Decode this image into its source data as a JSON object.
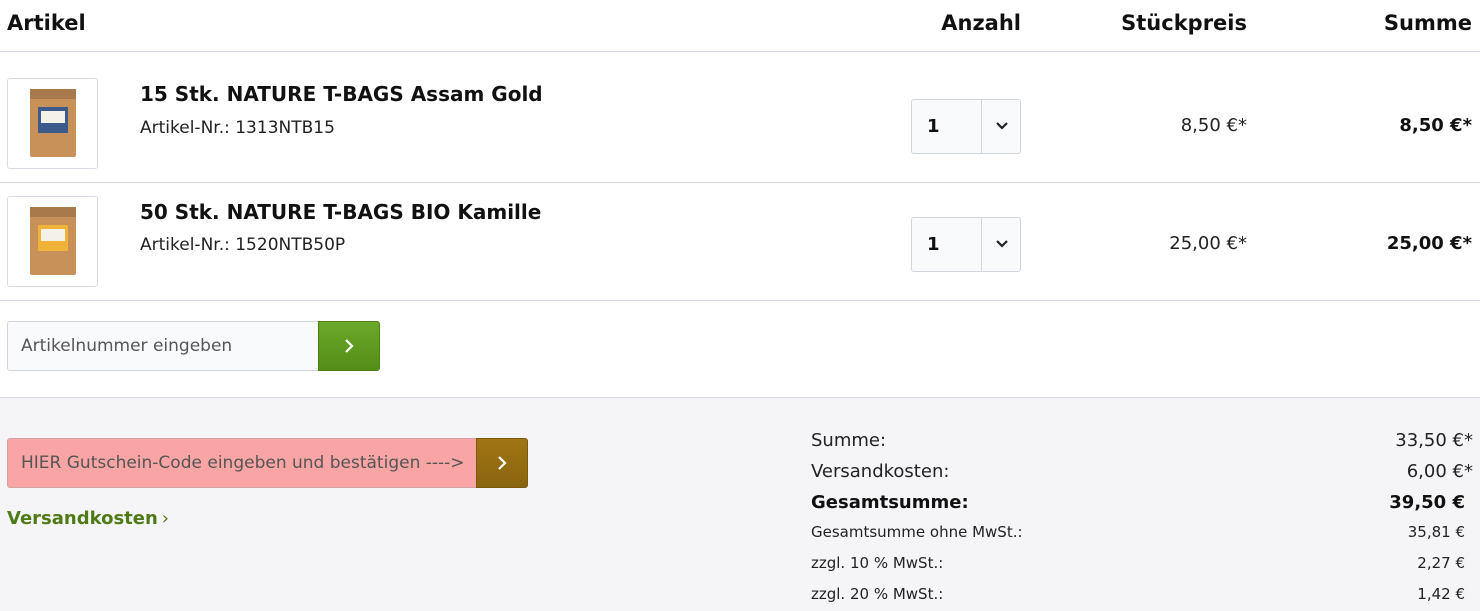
{
  "header": {
    "article": "Artikel",
    "quantity": "Anzahl",
    "unit_price": "Stückpreis",
    "sum": "Summe"
  },
  "items": [
    {
      "name": "15 Stk. NATURE T-BAGS Assam Gold",
      "article_no": "Artikel-Nr.: 1313NTB15",
      "quantity": "1",
      "unit_price": "8,50 €*",
      "total": "8,50 €*",
      "image_icon": "assam-gold-bag-image"
    },
    {
      "name": "50 Stk. NATURE T-BAGS BIO Kamille",
      "article_no": "Artikel-Nr.: 1520NTB50P",
      "quantity": "1",
      "unit_price": "25,00 €*",
      "total": "25,00 €*",
      "image_icon": "bio-kamille-bag-image"
    }
  ],
  "add_article": {
    "placeholder": "Artikelnummer eingeben"
  },
  "voucher": {
    "placeholder": "HIER Gutschein-Code eingeben und bestätigen ---->"
  },
  "shipping_link": "Versandkosten",
  "summary": {
    "sum_label": "Summe:",
    "sum_value": "33,50 €*",
    "shipping_label": "Versandkosten:",
    "shipping_value": "6,00 €*",
    "grand_label": "Gesamtsumme:",
    "grand_value": "39,50 €",
    "net_label": "Gesamtsumme ohne MwSt.:",
    "net_value": "35,81 €",
    "vat10_label": "zzgl. 10 % MwSt.:",
    "vat10_value": "2,27 €",
    "vat20_label": "zzgl. 20 % MwSt.:",
    "vat20_value": "1,42 €"
  },
  "colors": {
    "green_button": "#5f9c20",
    "voucher_bg": "#f9a5a5",
    "voucher_button": "#94690f",
    "link_green": "#4f7a15"
  }
}
